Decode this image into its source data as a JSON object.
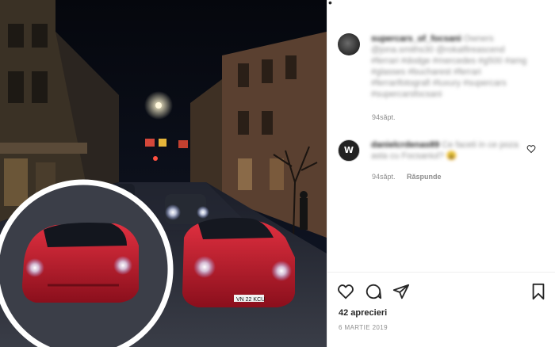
{
  "post": {
    "likes": "42 aprecieri",
    "date": "6 MARTIE 2019",
    "image_alt": "night street with two red sports cars"
  },
  "comments": [
    {
      "username": "supercars_of_focsani",
      "text": "Owners @jona.smiths30 @rokatfireascend #ferrari #dodge #mercedes #g500 #amg #glasses #bucharest #ferrari #ferrarifotografi #luxury #supercars #supercarsfocsani",
      "time": "94săpt."
    },
    {
      "username": "danielcrdenas89",
      "text": "Ce faceti in ce poza asta cu Focsaniul? 😩",
      "time": "94săpt.",
      "reply": "Răspunde"
    }
  ],
  "icons": {
    "like": "heart-icon",
    "comment": "comment-icon",
    "share": "share-icon",
    "save": "bookmark-icon",
    "comment_like": "heart-small-icon"
  },
  "colors": {
    "car": "#c8182a",
    "circle": "#ffffff",
    "night": "#0a0d18"
  }
}
